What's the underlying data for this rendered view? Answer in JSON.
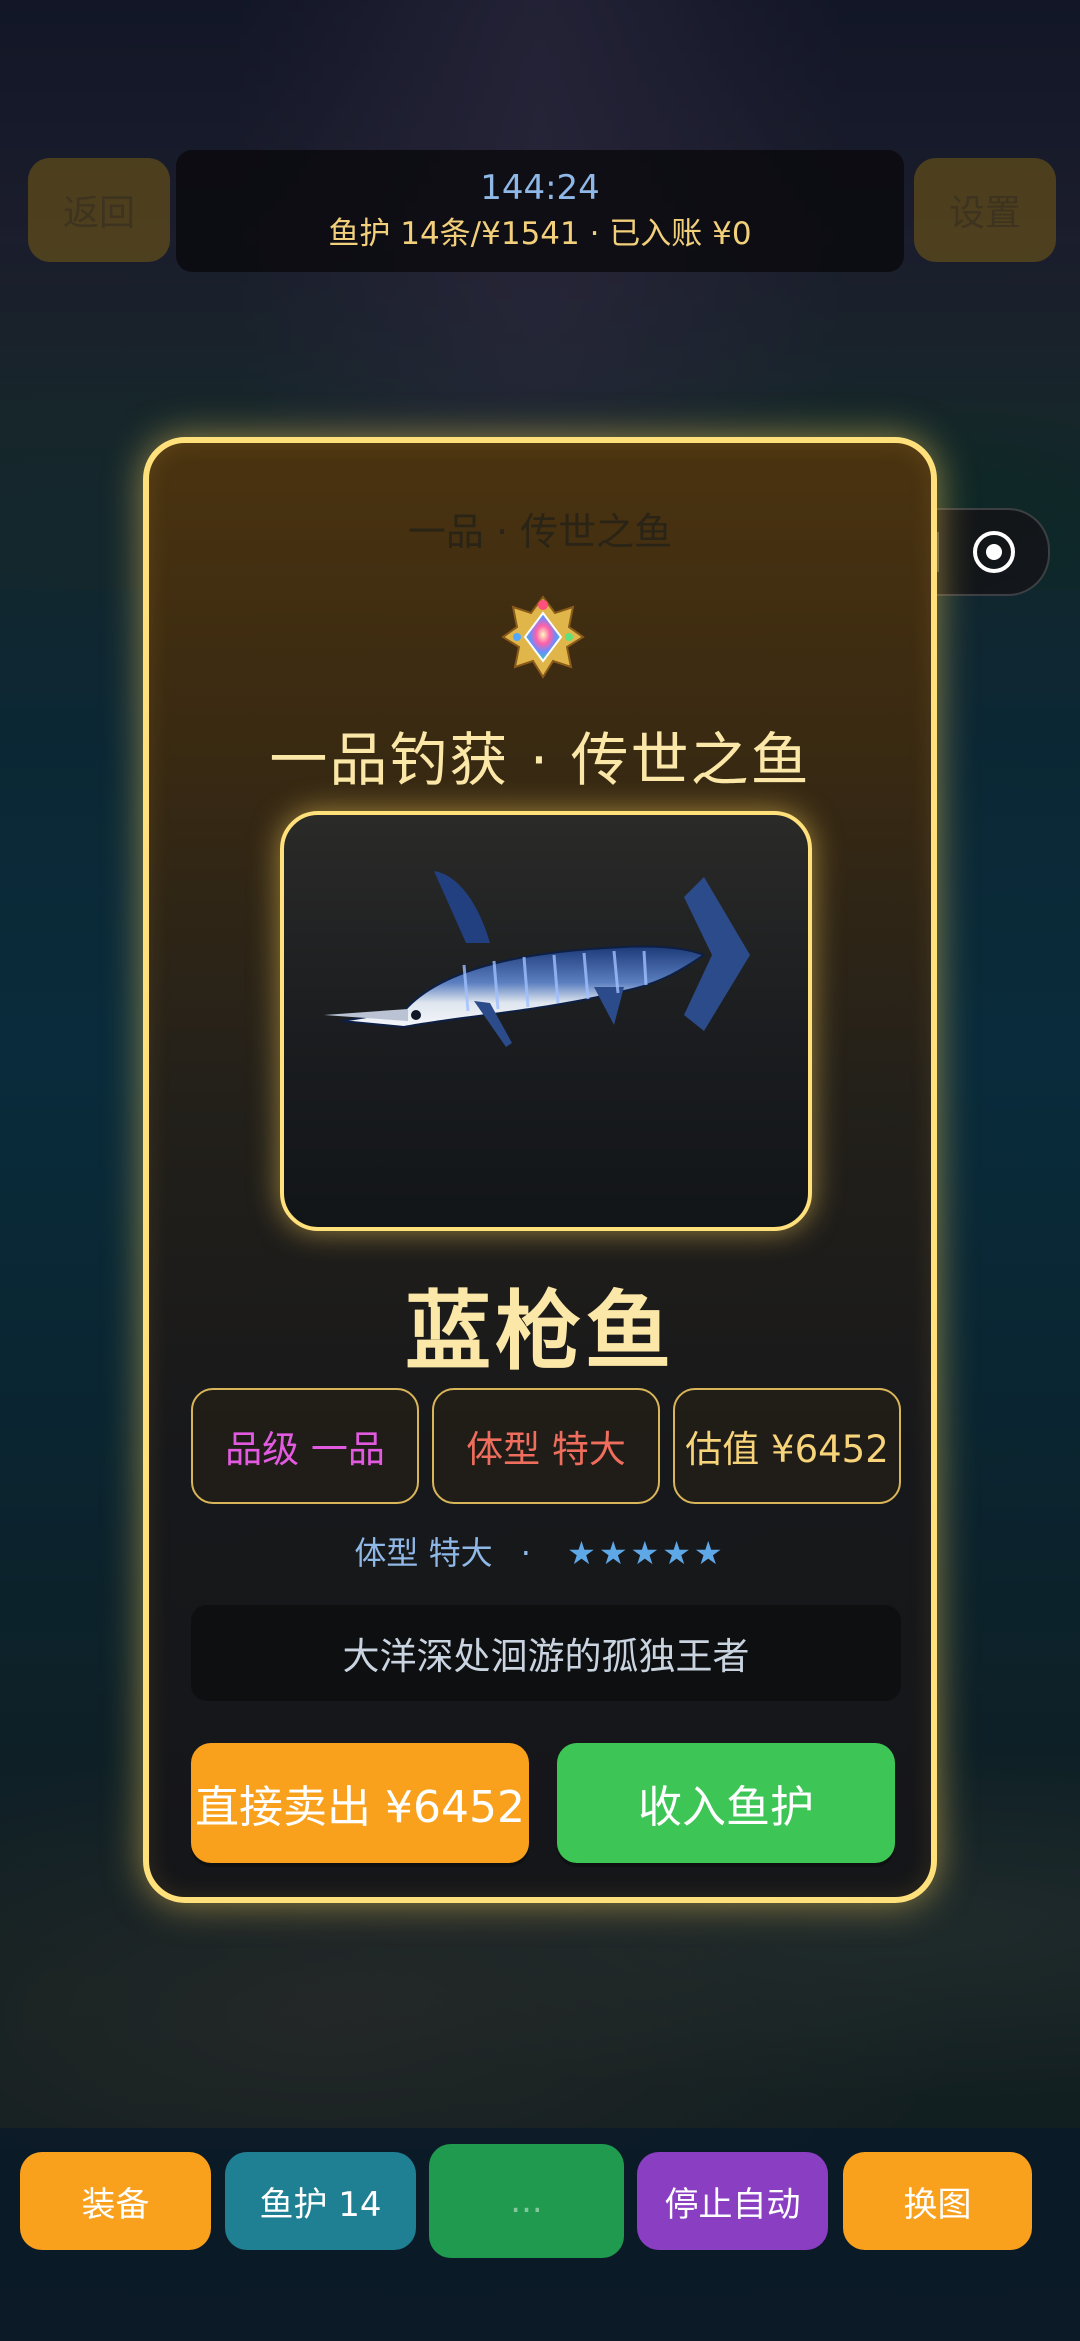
{
  "top": {
    "back_label": "返回",
    "settings_label": "设置",
    "timer": "144:24",
    "status_line": "鱼护 14条/¥1541 · 已入账 ¥0"
  },
  "capsule": {
    "more_icon": "more-dots-icon",
    "close_icon": "target-close-icon"
  },
  "card": {
    "rank_subtitle": "一品 · 传世之鱼",
    "emblem_icon": "rainbow-gem-crown-icon",
    "title": "一品钓获 · 传世之鱼",
    "fish_name": "蓝枪鱼",
    "tags": {
      "grade": "品级 一品",
      "size": "体型 特大",
      "value": "估值 ¥6452"
    },
    "size_line": {
      "label": "体型 特大",
      "separator": "·",
      "stars": "★★★★★",
      "star_count": 5
    },
    "description": "大洋深处洄游的孤独王者",
    "sell_button": "直接卖出 ¥6452",
    "keep_button": "收入鱼护"
  },
  "bottom_bar": {
    "equip": "装备",
    "keepnet": "鱼护 14",
    "cast": "...",
    "stop_auto": "停止自动",
    "change_map": "换图"
  },
  "colors": {
    "card_border": "#ffe07a",
    "sell": "#f9a01c",
    "keep": "#3dc655",
    "keepnet_btn": "#1f7f93",
    "stop_btn": "#8a3ec2"
  }
}
